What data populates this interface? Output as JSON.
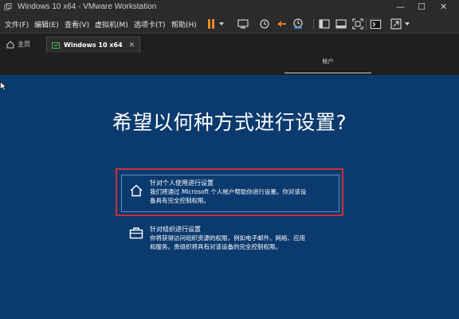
{
  "window": {
    "title": "Windows 10 x64 - VMware Workstation",
    "controls": {
      "minimize": "—",
      "maximize": "☐",
      "close": "✕"
    }
  },
  "menubar": {
    "items": [
      "文件(F)",
      "编辑(E)",
      "查看(V)",
      "虚拟机(M)",
      "选项卡(T)",
      "帮助(H)"
    ]
  },
  "toolbar": {
    "icons": [
      "pause-icon",
      "dropdown-arrow-icon",
      "send-ctrl-alt-del-icon",
      "snapshot-icon",
      "revert-snapshot-icon",
      "snapshot-manager-icon",
      "console-view-icon",
      "fullscreen-icon",
      "unity-icon",
      "single-window-icon",
      "stretch-icon",
      "view-dropdown-icon"
    ],
    "colors": {
      "pause": "#f08a24",
      "revert": "#e0762c"
    }
  },
  "tabs": [
    {
      "label": "主页",
      "active": false
    },
    {
      "label": "Windows 10 x64",
      "active": true,
      "close": "✕"
    }
  ],
  "vm_header": {
    "account_label": "帐户"
  },
  "setup": {
    "heading": "希望以何种方式进行设置?",
    "options": [
      {
        "title": "针对个人使用进行设置",
        "desc_line1": "我们将通过 Microsoft 个人帐户帮助你进行设置。你对该设",
        "desc_line2": "备具有完全控制权限。",
        "icon": "home-icon"
      },
      {
        "title": "针对组织进行设置",
        "desc_line1": "你将获得访问组织资源的权限，例如电子邮件、网络、应用",
        "desc_line2": "和服务。贵组织将具有对该设备的完全控制权限。",
        "icon": "briefcase-icon"
      }
    ],
    "colors": {
      "background": "#0b3a6e",
      "selected_border": "#5b8fc6",
      "highlight": "#c9303a"
    }
  }
}
